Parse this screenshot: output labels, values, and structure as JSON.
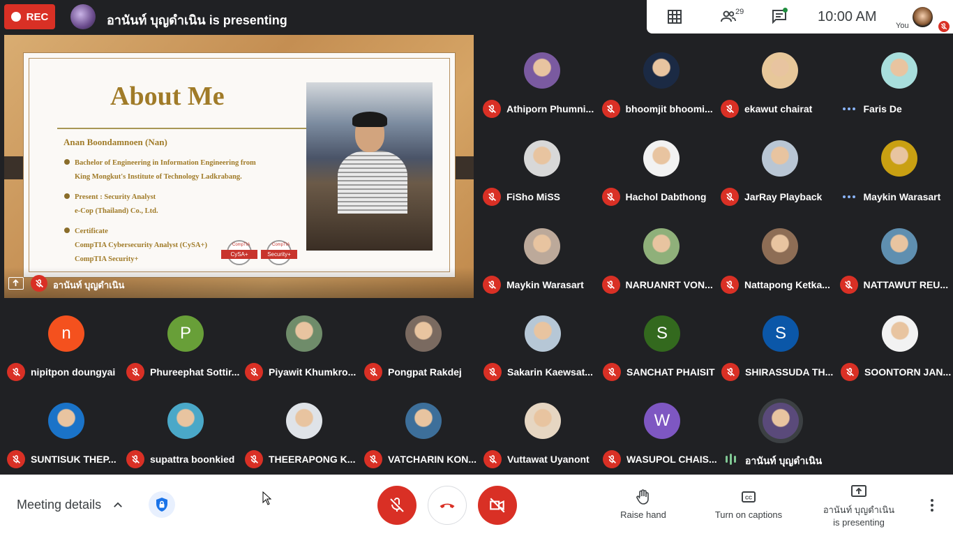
{
  "top_bar": {
    "rec_label": "REC",
    "presenting_title": "อานันท์ บุญดำเนิน is presenting",
    "people_count": "29",
    "clock": "10:00  AM",
    "you_label": "You"
  },
  "presentation": {
    "presenter_name": "อานันท์ บุญดำเนิน",
    "slide": {
      "title": "About Me",
      "name": "Anan Boondamnoen (Nan)",
      "bullets": [
        {
          "line1": "Bachelor of Engineering in Information Engineering from",
          "line2": "King Mongkut's Institute of Technology Ladkrabang."
        },
        {
          "line1": "Present : Security Analyst",
          "line2": "e-Cop (Thailand) Co., Ltd."
        },
        {
          "line1": "Certificate",
          "line2": "CompTIA Cybersecurity Analyst (CySA+)",
          "line3": "CompTIA Security+"
        }
      ],
      "badges": [
        {
          "top": "CompTIA",
          "label": "CySA+"
        },
        {
          "top": "CompTIA",
          "label": "Security+"
        }
      ]
    }
  },
  "participants": [
    {
      "name": "Athiporn Phumni...",
      "status": "muted",
      "avatar_color": "#7a5aa0"
    },
    {
      "name": "bhoomjit bhoomi...",
      "status": "muted",
      "avatar_color": "#1b2a44"
    },
    {
      "name": "ekawut chairat",
      "status": "muted",
      "avatar_color": "#e7c79a"
    },
    {
      "name": "Faris De",
      "status": "more",
      "avatar_color": "#a8dedc"
    },
    {
      "name": "FiSho MiSS",
      "status": "muted",
      "avatar_color": "#d8d8d8"
    },
    {
      "name": "Hachol Dabthong",
      "status": "muted",
      "avatar_color": "#f2f2f2"
    },
    {
      "name": "JarRay Playback",
      "status": "muted",
      "avatar_color": "#b9c6d4"
    },
    {
      "name": "Maykin Warasart",
      "status": "more",
      "avatar_color": "#c9a012"
    },
    {
      "name": "Maykin Warasart",
      "status": "muted",
      "avatar_color": "#bca99a"
    },
    {
      "name": "NARUANRT VON...",
      "status": "muted",
      "avatar_color": "#8fb07a"
    },
    {
      "name": "Nattapong Ketka...",
      "status": "muted",
      "avatar_color": "#8d6d55"
    },
    {
      "name": "NATTAWUT REU...",
      "status": "muted",
      "avatar_color": "#5f8fb0"
    },
    {
      "name": "nipitpon doungyai",
      "status": "muted",
      "avatar_color": "#f4511e",
      "initial": "n"
    },
    {
      "name": "Phureephat Sottir...",
      "status": "muted",
      "avatar_color": "#689f38",
      "initial": "P"
    },
    {
      "name": "Piyawit Khumkro...",
      "status": "muted",
      "avatar_color": "#6f8c6a"
    },
    {
      "name": "Pongpat Rakdej",
      "status": "muted",
      "avatar_color": "#7a6a60"
    },
    {
      "name": "Sakarin Kaewsat...",
      "status": "muted",
      "avatar_color": "#b6c7d6"
    },
    {
      "name": "SANCHAT PHAISIT",
      "status": "muted",
      "avatar_color": "#33691e",
      "initial": "S"
    },
    {
      "name": "SHIRASSUDA TH...",
      "status": "muted",
      "avatar_color": "#0b57a8",
      "initial": "S"
    },
    {
      "name": "SOONTORN JAN...",
      "status": "muted",
      "avatar_color": "#f2f2f2"
    },
    {
      "name": "SUNTISUK THEP...",
      "status": "muted",
      "avatar_color": "#1a73c8"
    },
    {
      "name": "supattra boonkied",
      "status": "muted",
      "avatar_color": "#4aa8c8"
    },
    {
      "name": "THEERAPONG K...",
      "status": "muted",
      "avatar_color": "#dfe3e8"
    },
    {
      "name": "VATCHARIN KON...",
      "status": "muted",
      "avatar_color": "#3d6f9a"
    },
    {
      "name": "Vuttawat Uyanont",
      "status": "muted",
      "avatar_color": "#e6d6c2"
    },
    {
      "name": "WASUPOL CHAIS...",
      "status": "muted",
      "avatar_color": "#7e57c2",
      "initial": "W"
    },
    {
      "name": "อานันท์ บุญดำเนิน",
      "status": "speaking",
      "avatar_color": "#5a4a7a"
    }
  ],
  "bottom_bar": {
    "meeting_details": "Meeting details",
    "raise_hand": "Raise hand",
    "captions": "Turn on captions",
    "presenting_line1": "อานันท์ บุญดำเนิน",
    "presenting_line2": "is presenting"
  },
  "colors": {
    "danger": "#d93025",
    "accent": "#1a73e8",
    "background": "#202124"
  }
}
